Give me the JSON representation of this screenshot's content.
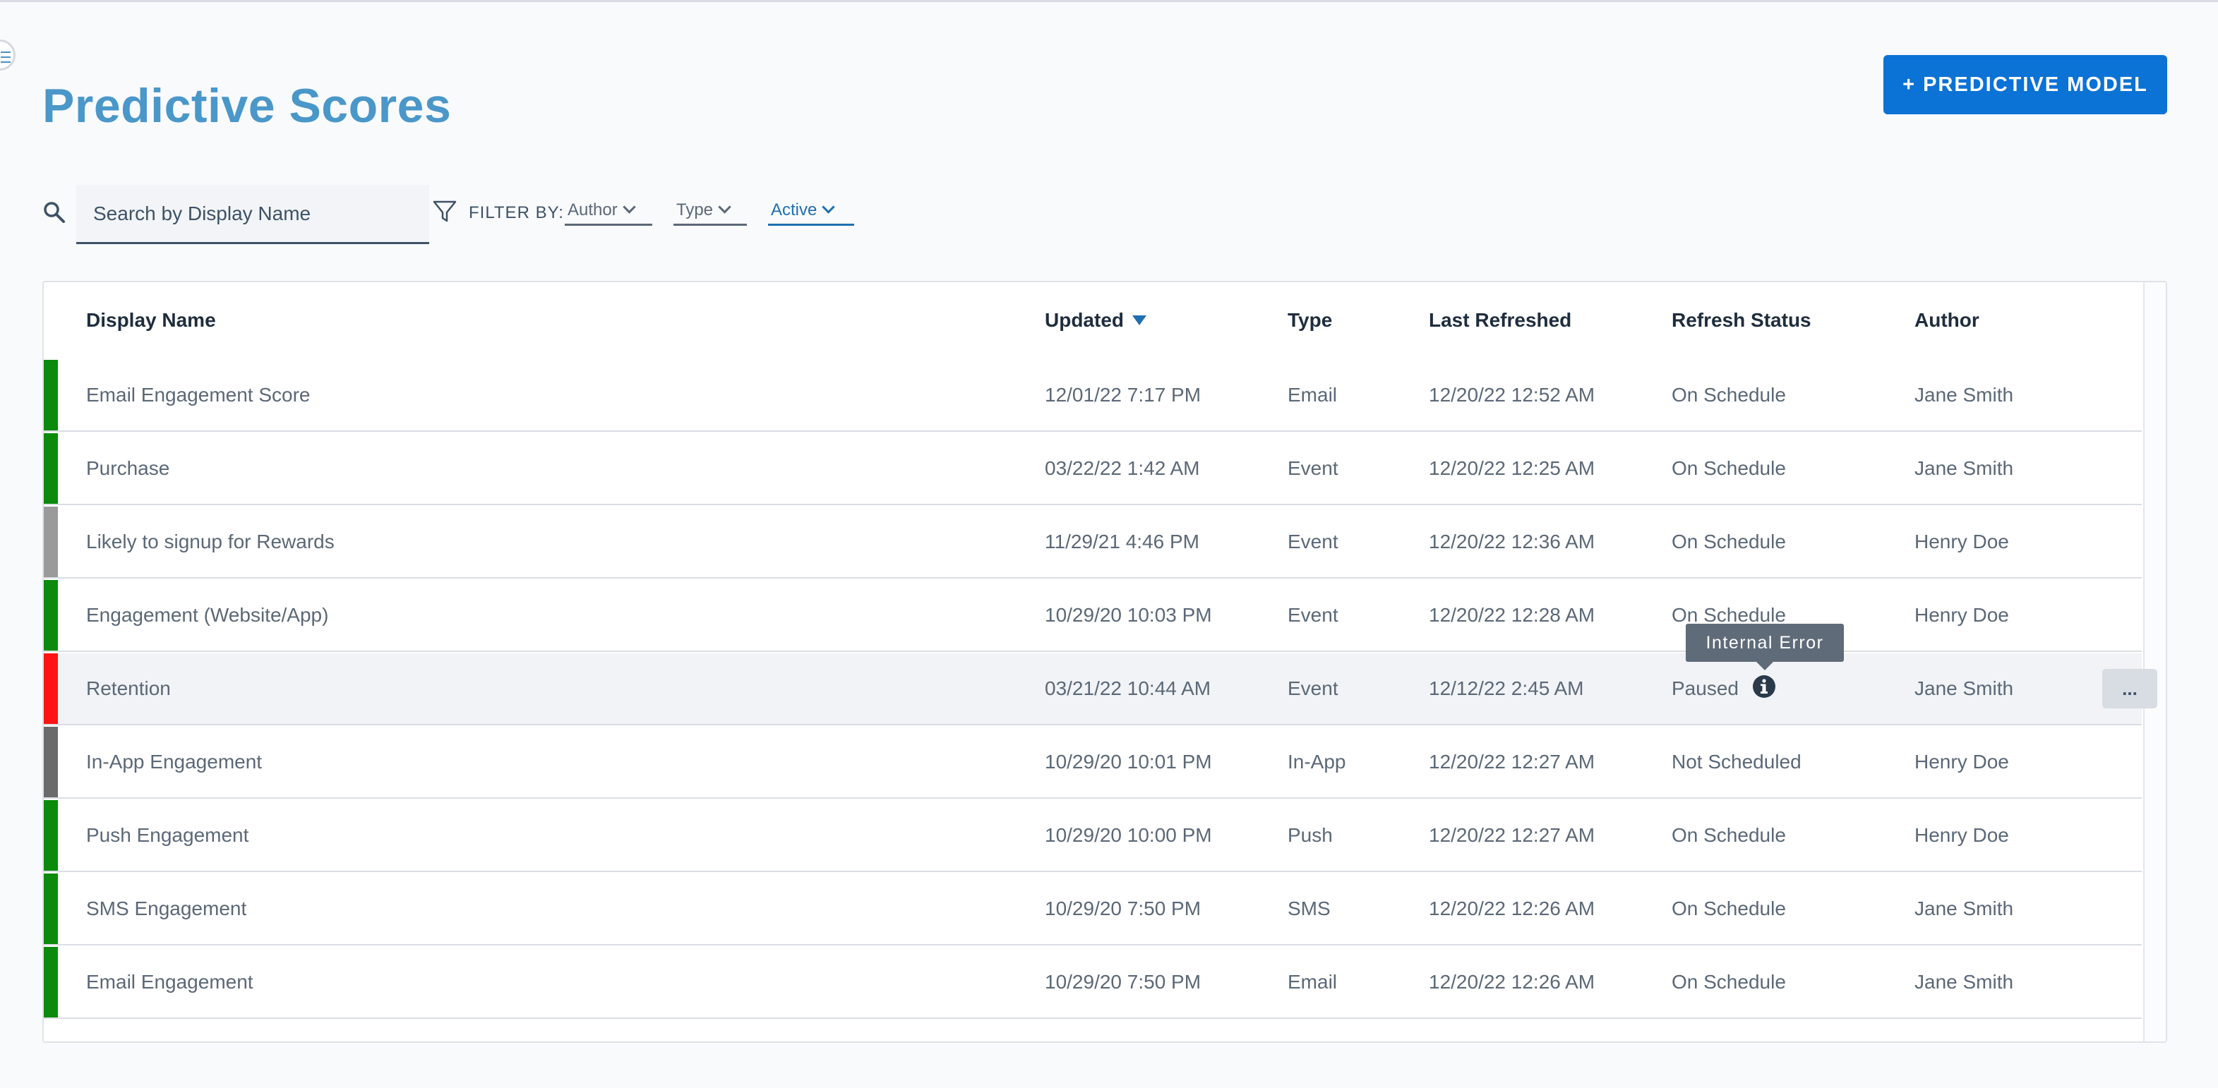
{
  "page": {
    "title": "Predictive Scores",
    "primary_button": "+ PREDICTIVE MODEL"
  },
  "search": {
    "placeholder": "Search by Display Name",
    "value": ""
  },
  "filters": {
    "label": "FILTER BY:",
    "dropdowns": [
      "Author",
      "Type",
      "Active"
    ]
  },
  "table": {
    "columns": [
      "Display Name",
      "Updated",
      "Type",
      "Last Refreshed",
      "Refresh Status",
      "Author"
    ],
    "sorted_column": "Updated",
    "sort_direction": "descending",
    "rows": [
      {
        "name": "Email Engagement Score",
        "updated": "12/01/22 7:17 PM",
        "type": "Email",
        "last_refreshed": "12/20/22 12:52 AM",
        "status": "On Schedule",
        "author": "Jane Smith",
        "indicator": "green"
      },
      {
        "name": "Purchase",
        "updated": "03/22/22 1:42 AM",
        "type": "Event",
        "last_refreshed": "12/20/22 12:25 AM",
        "status": "On Schedule",
        "author": "Jane Smith",
        "indicator": "green"
      },
      {
        "name": "Likely to signup for Rewards",
        "updated": "11/29/21 4:46 PM",
        "type": "Event",
        "last_refreshed": "12/20/22 12:36 AM",
        "status": "On Schedule",
        "author": "Henry Doe",
        "indicator": "gray"
      },
      {
        "name": "Engagement (Website/App)",
        "updated": "10/29/20 10:03 PM",
        "type": "Event",
        "last_refreshed": "12/20/22 12:28 AM",
        "status": "On Schedule",
        "author": "Henry Doe",
        "indicator": "green"
      },
      {
        "name": "Retention",
        "updated": "03/21/22 10:44 AM",
        "type": "Event",
        "last_refreshed": "12/12/22 2:45 AM",
        "status": "Paused",
        "author": "Jane Smith",
        "indicator": "red"
      },
      {
        "name": "In-App Engagement",
        "updated": "10/29/20 10:01 PM",
        "type": "In-App",
        "last_refreshed": "12/20/22 12:27 AM",
        "status": "Not Scheduled",
        "author": "Henry Doe",
        "indicator": "dark-gray"
      },
      {
        "name": "Push Engagement",
        "updated": "10/29/20 10:00 PM",
        "type": "Push",
        "last_refreshed": "12/20/22 12:27 AM",
        "status": "On Schedule",
        "author": "Henry Doe",
        "indicator": "green"
      },
      {
        "name": "SMS Engagement",
        "updated": "10/29/20 7:50 PM",
        "type": "SMS",
        "last_refreshed": "12/20/22 12:26 AM",
        "status": "On Schedule",
        "author": "Jane Smith",
        "indicator": "green"
      },
      {
        "name": "Email Engagement",
        "updated": "10/29/20 7:50 PM",
        "type": "Email",
        "last_refreshed": "12/20/22 12:26 AM",
        "status": "On Schedule",
        "author": "Jane Smith",
        "indicator": "green"
      }
    ]
  },
  "tooltip": {
    "text": "Internal Error"
  },
  "row_actions": {
    "more_label": "..."
  },
  "icons": {
    "menu": "menu-icon",
    "search": "search-icon",
    "filter": "filter-icon",
    "info": "info-icon",
    "chevron": "chevron-down-icon",
    "sort": "sort-descending-icon"
  },
  "colors": {
    "title": "#4a97c9",
    "primary_button": "#0b72d6",
    "accent": "#1f6fb0",
    "indicator_green": "#0b8a0b",
    "indicator_red": "#ff1414",
    "indicator_gray": "#9a9a9a",
    "indicator_dark_gray": "#6b6b6b",
    "tooltip": "#5f6b78"
  }
}
